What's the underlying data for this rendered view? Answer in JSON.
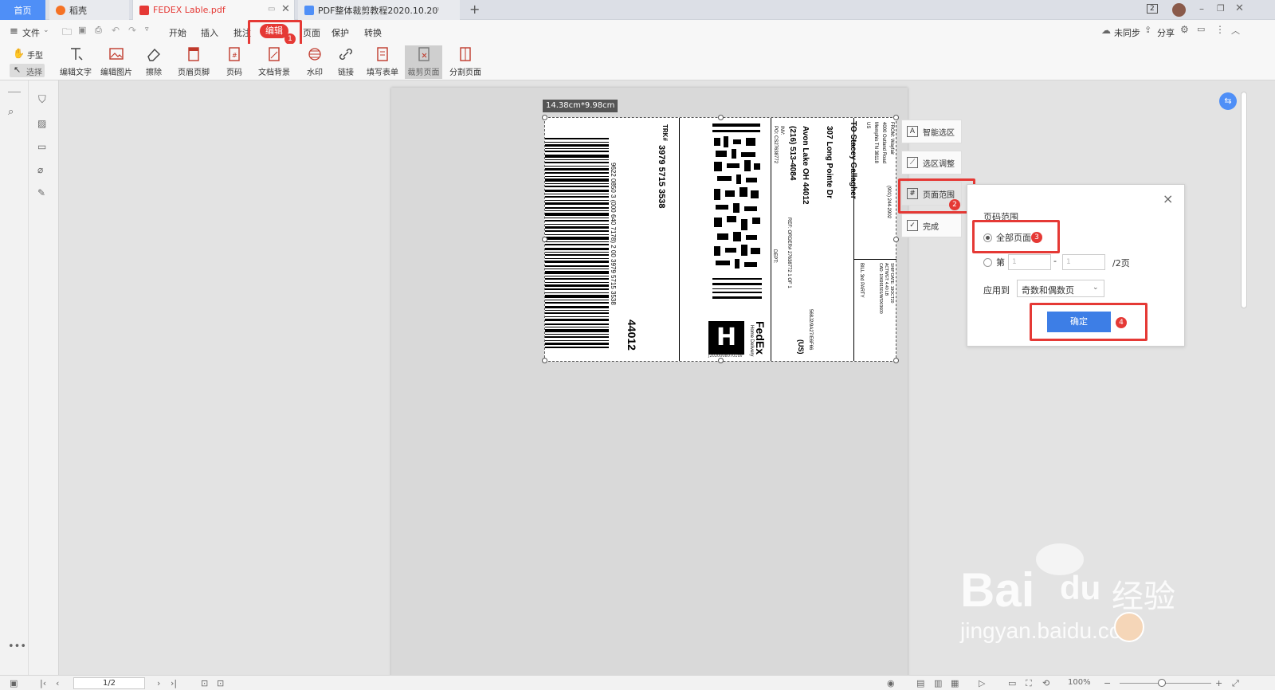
{
  "tabs": {
    "home": "首页",
    "daoke": "稻壳",
    "fedex": "FEDEX Lable.pdf",
    "pdf_tutorial": "PDF整体裁剪教程2020.10.20",
    "new_tab": "+",
    "tab_count": "2"
  },
  "menu": {
    "file": "文件",
    "items": [
      "开始",
      "插入",
      "批注",
      "编辑",
      "页面",
      "保护",
      "转换"
    ],
    "sync": "未同步",
    "share": "分享"
  },
  "toolbar": {
    "hand": "手型",
    "select": "选择",
    "buttons": [
      "编辑文字",
      "编辑图片",
      "擦除",
      "页眉页脚",
      "页码",
      "文档背景",
      "水印",
      "链接",
      "填写表单",
      "裁剪页面",
      "分割页面"
    ]
  },
  "size_badge": "14.38cm*9.98cm",
  "label": {
    "trk_label": "TRK#",
    "tracking": "3979 5715 3538",
    "barcode_text": "9622 0850 3 (000 640 7178) 2 00 3979 5715 3538",
    "zip": "44012",
    "to_name": "TO Stacey Gallagher",
    "address": "307 Long Pointe Dr",
    "city": "Avon Lake OH 44012",
    "phone": "(216) 513-4084",
    "inv": "INV:",
    "po": "PO: CS27638772",
    "ref": "REF: ORDER# 27638772 1 OF 1",
    "dept": "DEPT:",
    "from_head": "FROM: Wayfair",
    "from_addr": "4000 Outland Road",
    "from_city": "Memphis TN 38118",
    "from_country": "US",
    "from_phone": "(901) 244-2902",
    "ship_info": "SHIP DATE: 19OCT20",
    "actwgt": "ACTWGT: 4.40 LB",
    "cad": "CAD: 106991501/WSXI3600",
    "bill": "BILL 3rd PARTY",
    "fedex": "FedEx",
    "home_delivery": "Home Delivery",
    "h_letter": "H",
    "bottom_code": "J20200080701uv",
    "us": "(US)",
    "track_code": "568J2/9A27/E6F66"
  },
  "crop_menu": {
    "smart": "智能选区",
    "adjust": "选区调整",
    "range": "页面范围",
    "done": "完成"
  },
  "popup": {
    "title": "页码范围",
    "all_pages": "全部页面",
    "range_prefix": "第",
    "from": "1",
    "dash": "-",
    "to": "1",
    "total": "/2页",
    "apply_label": "应用到",
    "apply_value": "奇数和偶数页",
    "confirm": "确定",
    "close": "×"
  },
  "steps": [
    "1",
    "2",
    "3",
    "4"
  ],
  "status": {
    "page": "1/2",
    "zoom": "100%"
  },
  "watermark": {
    "bai": "Bai",
    "du": "du",
    "jingyan": "经验",
    "url": "jingyan.baidu.com"
  },
  "colors": {
    "accent": "#4f8ff7",
    "red": "#e53935",
    "confirm": "#3d7ee6"
  }
}
